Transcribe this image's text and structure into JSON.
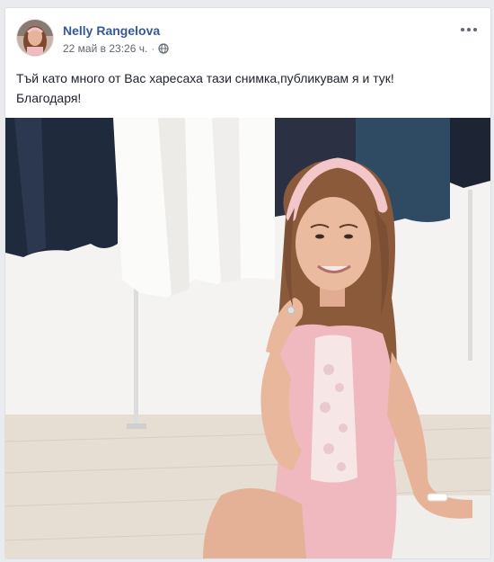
{
  "post": {
    "author": "Nelly Rangelova",
    "timestamp": "22 май в 23:26 ч.",
    "separator": "·",
    "privacy_icon": "globe-icon",
    "text_line1": "Тъй като много от Вас харесаха тази снимка,публикувам я и тук!",
    "text_line2": "Благодаря!"
  },
  "colors": {
    "author_link": "#385898",
    "card_bg": "#ffffff",
    "page_bg": "#e9ebee",
    "top_pink": "#f3c7c9",
    "dress_pink": "#f0b9bf"
  }
}
